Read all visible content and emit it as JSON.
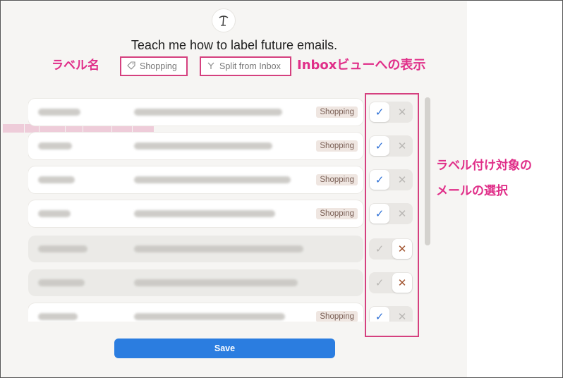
{
  "header": {
    "title": "Teach me how to label future emails."
  },
  "chips": {
    "label_name": "Shopping",
    "split_option": "Split from Inbox"
  },
  "annotations": {
    "label_name": "ラベル名",
    "inbox_view": "Inboxビューへの表示",
    "target_line1": "ラベル付け対象の",
    "target_line2": "メールの選択"
  },
  "icons": {
    "logo": "palm-tree-logo-icon",
    "label_chip": "tag-icon",
    "split_chip": "split-arrow-icon",
    "include": "check-icon",
    "exclude": "close-icon"
  },
  "colors": {
    "accent_blue": "#2b7de0",
    "annotation_pink": "#e02f89",
    "badge_bg": "#efe6e1",
    "check_blue": "#2c6fd6",
    "cross_brown": "#a0522d"
  },
  "emails": [
    {
      "badge": "Shopping",
      "selected": "include"
    },
    {
      "badge": "Shopping",
      "selected": "include"
    },
    {
      "badge": "Shopping",
      "selected": "include"
    },
    {
      "badge": "Shopping",
      "selected": "include"
    },
    {
      "badge": "",
      "selected": "exclude"
    },
    {
      "badge": "",
      "selected": "exclude"
    },
    {
      "badge": "Shopping",
      "selected": "include"
    }
  ],
  "actions": {
    "save_label": "Save"
  }
}
